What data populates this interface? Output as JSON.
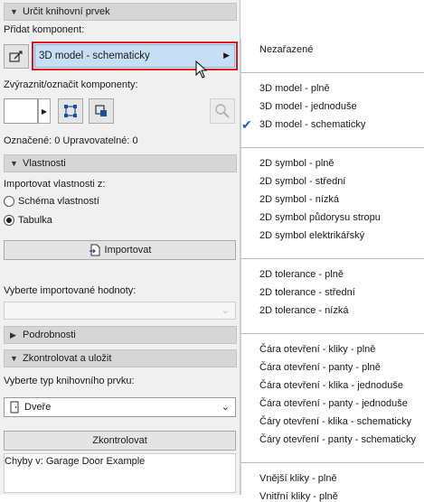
{
  "panel": {
    "section_identify": "Určit knihovní prvek",
    "add_component_label": "Přidat komponent:",
    "component_select": "3D model - schematicky",
    "highlight_label": "Zvýraznit/označit komponenty:",
    "marked_status": "Označené: 0 Upravovatelné: 0",
    "section_properties": "Vlastnosti",
    "import_from_label": "Importovat vlastnosti z:",
    "radio_schema": "Schéma vlastností",
    "radio_table": "Tabulka",
    "import_button": "Importovat",
    "select_values_label": "Vyberte importované hodnoty:",
    "section_details": "Podrobnosti",
    "section_check_save": "Zkontrolovat a uložit",
    "type_label": "Vyberte typ knihovního prvku:",
    "type_value": "Dveře",
    "check_button": "Zkontrolovat",
    "errors_text": "Chyby v: Garage Door Example"
  },
  "menu": {
    "groups": [
      [
        "Nezařazené"
      ],
      [
        "3D model - plně",
        "3D model - jednoduše",
        "3D model - schematicky"
      ],
      [
        "2D symbol - plně",
        "2D symbol - střední",
        "2D symbol - nízká",
        "2D symbol půdorysu stropu",
        "2D symbol elektrikářský"
      ],
      [
        "2D tolerance - plně",
        "2D tolerance - střední",
        "2D tolerance - nízká"
      ],
      [
        "Čára otevření - kliky - plně",
        "Čára otevření - panty - plně",
        "Čára otevření - klika - jednoduše",
        "Čára otevření - panty - jednoduše",
        "Čáry otevření - klika - schematicky",
        "Čáry otevření - panty - schematicky"
      ],
      [
        "Vnější kliky - plně",
        "Vnitřní kliky - plně"
      ]
    ],
    "checked_item": "3D model - schematicky"
  },
  "colors": {
    "highlight_border": "#e0141c",
    "select_fill": "#c6dff5",
    "check_mark": "#1a5fc6"
  }
}
